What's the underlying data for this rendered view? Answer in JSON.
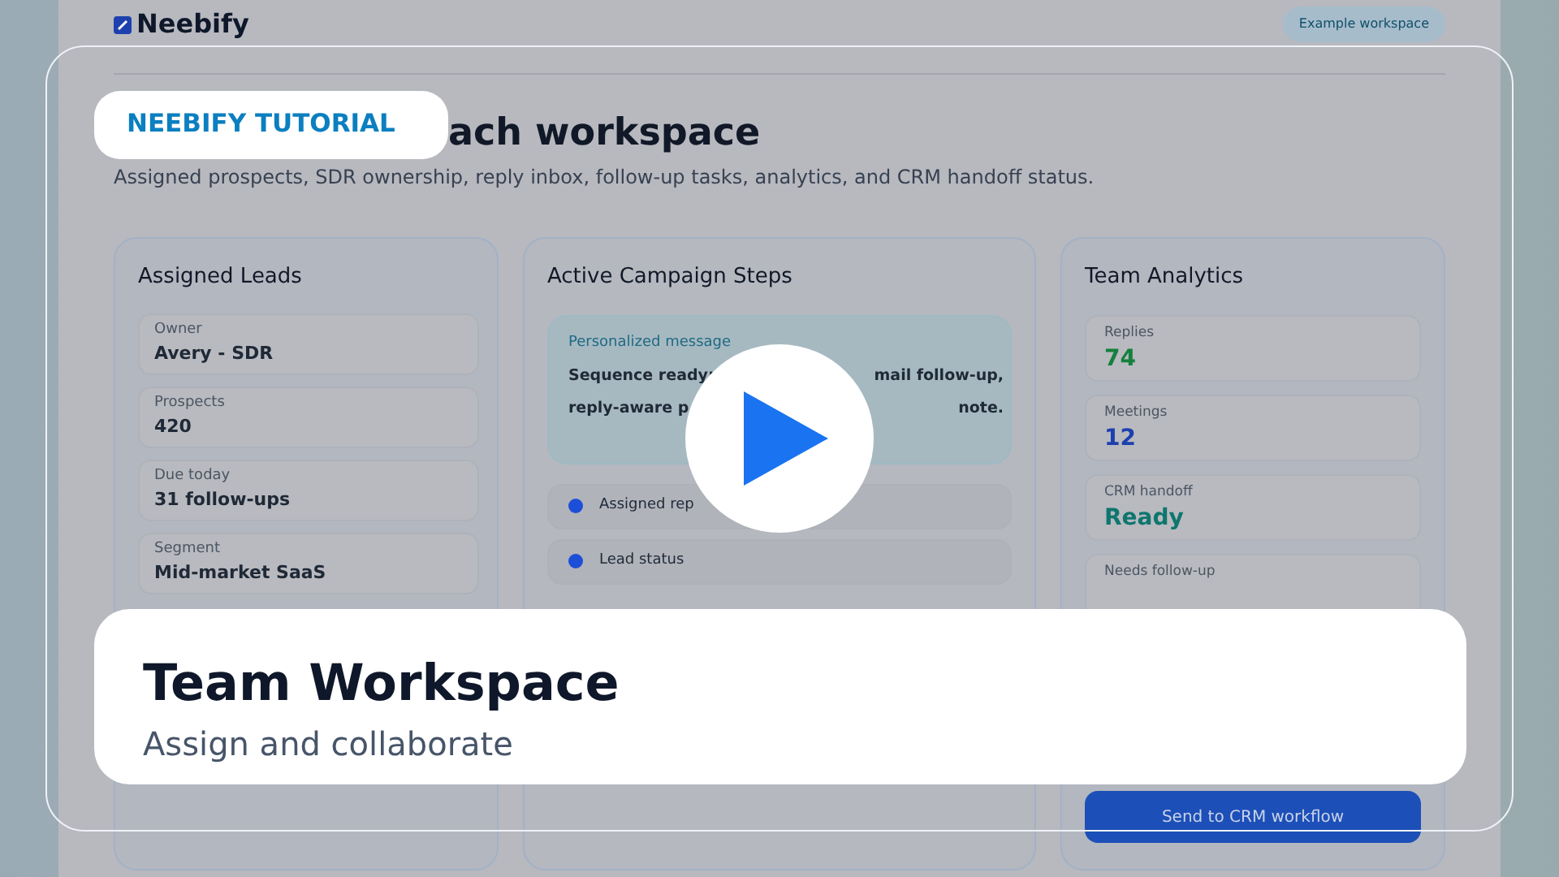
{
  "brand": {
    "name": "Neebify"
  },
  "workspace_badge": "Example workspace",
  "tutorial_badge": "NEEBIFY TUTORIAL",
  "page": {
    "title": "ach workspace",
    "subtitle": "Assigned prospects, SDR ownership, reply inbox, follow-up tasks, analytics, and CRM handoff status."
  },
  "leads": {
    "title": "Assigned Leads",
    "fields": [
      {
        "label": "Owner",
        "value": "Avery - SDR"
      },
      {
        "label": "Prospects",
        "value": "420"
      },
      {
        "label": "Due today",
        "value": "31 follow-ups"
      },
      {
        "label": "Segment",
        "value": "Mid-market SaaS"
      }
    ]
  },
  "campaign": {
    "title": "Active Campaign Steps",
    "message": {
      "label": "Personalized message",
      "lines": [
        {
          "left": "Sequence ready:",
          "right": "mail follow-up,"
        },
        {
          "left": "reply-aware p",
          "right": "note."
        }
      ]
    },
    "steps": [
      {
        "label": "Assigned rep"
      },
      {
        "label": "Lead status"
      }
    ]
  },
  "analytics": {
    "title": "Team Analytics",
    "stats": [
      {
        "label": "Replies",
        "value": "74",
        "color": "#15803d"
      },
      {
        "label": "Meetings",
        "value": "12",
        "color": "#1e40af"
      },
      {
        "label": "CRM handoff",
        "value": "Ready",
        "color": "#0f766e"
      },
      {
        "label": "Needs follow-up"
      }
    ],
    "button": "Send to CRM workflow"
  },
  "caption": {
    "title": "Team Workspace",
    "subtitle": "Assign and collaborate"
  }
}
